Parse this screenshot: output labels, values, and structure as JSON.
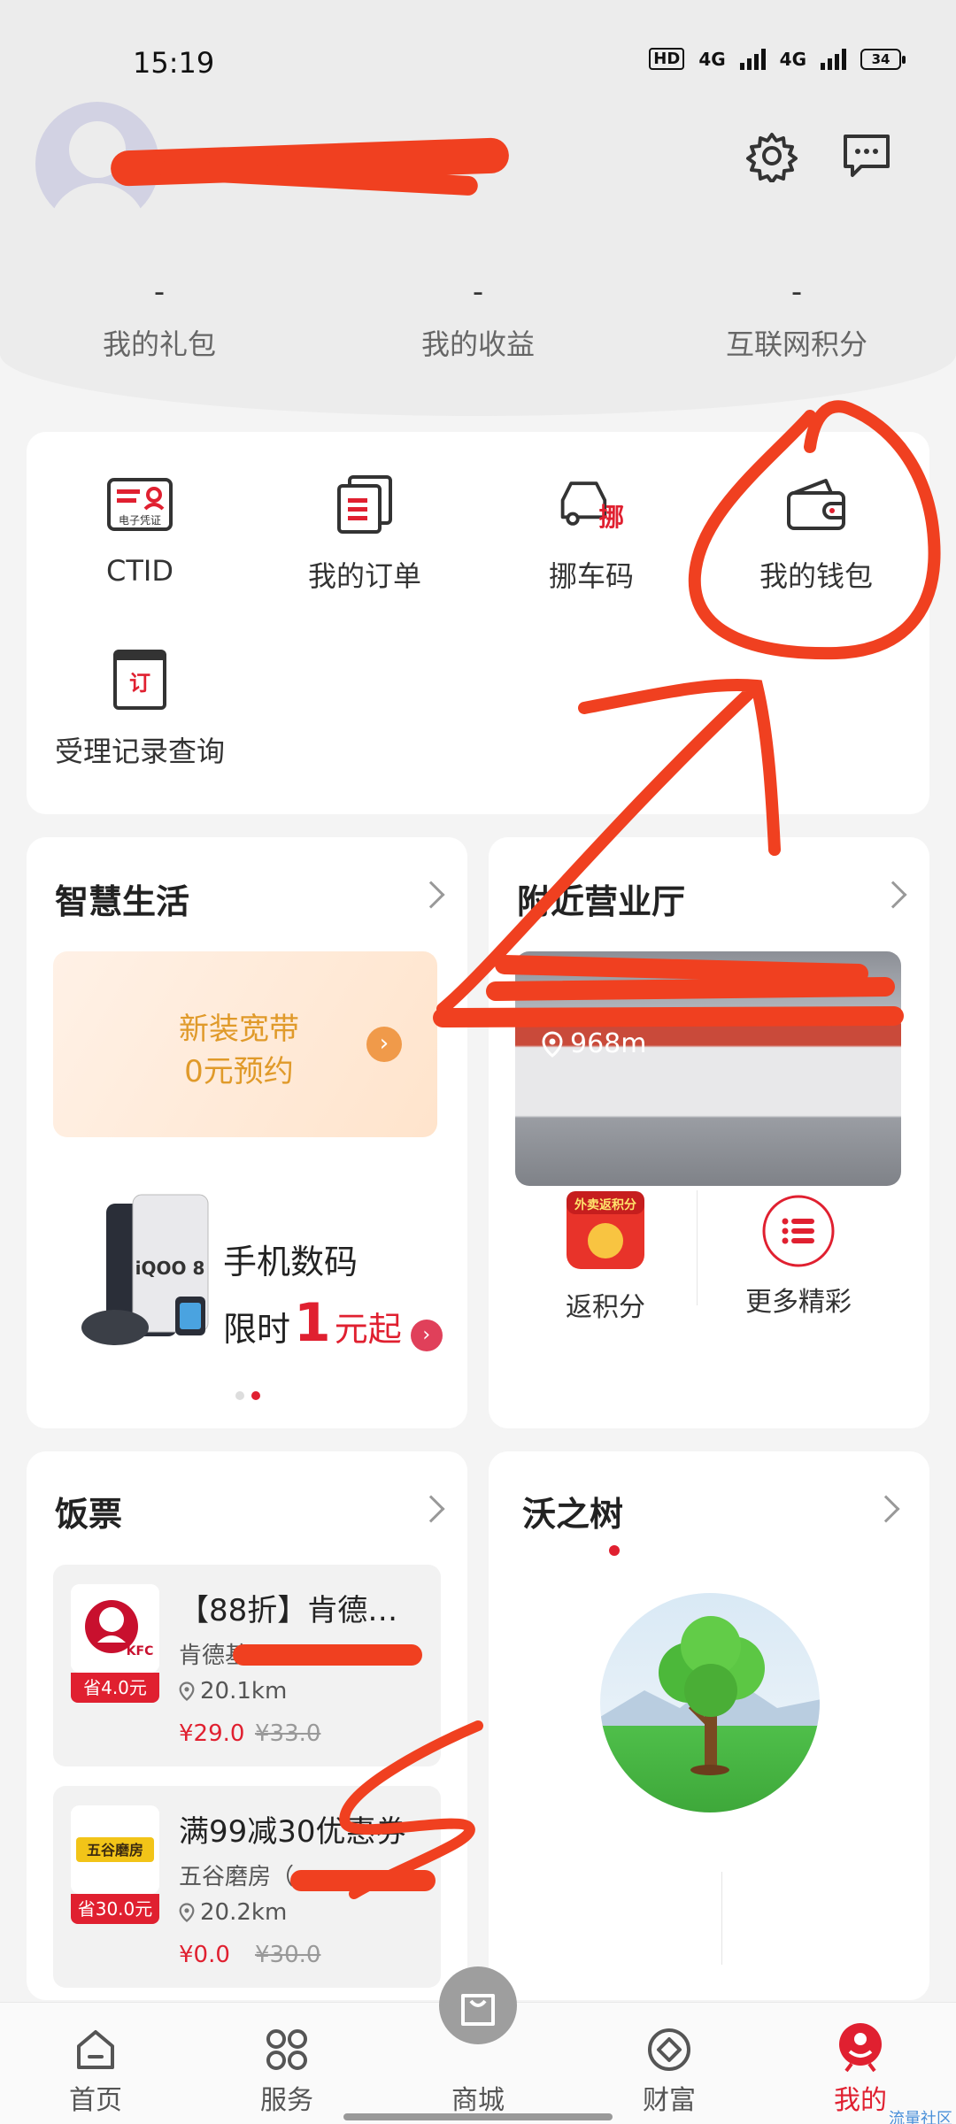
{
  "status_bar": {
    "time": "15:19",
    "hd_badge": "HD",
    "network_1": "4G",
    "network_2": "4G",
    "battery": "34"
  },
  "header": {
    "stats": [
      {
        "value": "-",
        "label": "我的礼包"
      },
      {
        "value": "-",
        "label": "我的收益"
      },
      {
        "value": "-",
        "label": "互联网积分"
      }
    ]
  },
  "quick_actions": [
    {
      "label": "CTID",
      "icon": "ctid-card-icon"
    },
    {
      "label": "我的订单",
      "icon": "orders-icon"
    },
    {
      "label": "挪车码",
      "icon": "move-car-icon",
      "icon_text": "挪"
    },
    {
      "label": "我的钱包",
      "icon": "wallet-icon"
    },
    {
      "label": "受理记录查询",
      "icon": "record-icon",
      "icon_text": "订"
    }
  ],
  "quick_action_icon_text": {
    "ctid_top": "电子凭证"
  },
  "smart_life": {
    "title": "智慧生活",
    "promo_line1": "新装宽带",
    "promo_line2": "0元预约",
    "phone_title": "手机数码",
    "phone_prefix": "限时",
    "phone_big": "1",
    "phone_suffix": "元起",
    "phone_brand": "iQOO 8"
  },
  "nearby_hall": {
    "title": "附近营业厅",
    "distance": "968m",
    "tiles": [
      {
        "label": "返积分",
        "icon": "points-icon",
        "badge": "外卖返积分"
      },
      {
        "label": "更多精彩",
        "icon": "list-icon"
      }
    ]
  },
  "meal_tickets": {
    "title": "饭票",
    "items": [
      {
        "title": "【88折】肯德…",
        "shop": "肯德基",
        "distance": "20.1km",
        "price": "¥29.0",
        "orig_price": "¥33.0",
        "save": "省4.0元",
        "logo_text": "KFC"
      },
      {
        "title": "满99减30优惠券",
        "shop": "五谷磨房（",
        "distance": "20.2km",
        "price": "¥0.0",
        "orig_price": "¥30.0",
        "save": "省30.0元",
        "logo_text": "五谷磨房"
      }
    ]
  },
  "wo_tree": {
    "title": "沃之树"
  },
  "tabbar": [
    {
      "label": "首页",
      "icon": "home-icon"
    },
    {
      "label": "服务",
      "icon": "services-icon"
    },
    {
      "label": "商城",
      "icon": "shopping-bag-icon"
    },
    {
      "label": "财富",
      "icon": "wealth-icon"
    },
    {
      "label": "我的",
      "icon": "profile-icon"
    }
  ],
  "watermark": "流量社区",
  "colors": {
    "accent": "#e02030",
    "annotation": "#f04020",
    "promo_text": "#e09a2a"
  }
}
